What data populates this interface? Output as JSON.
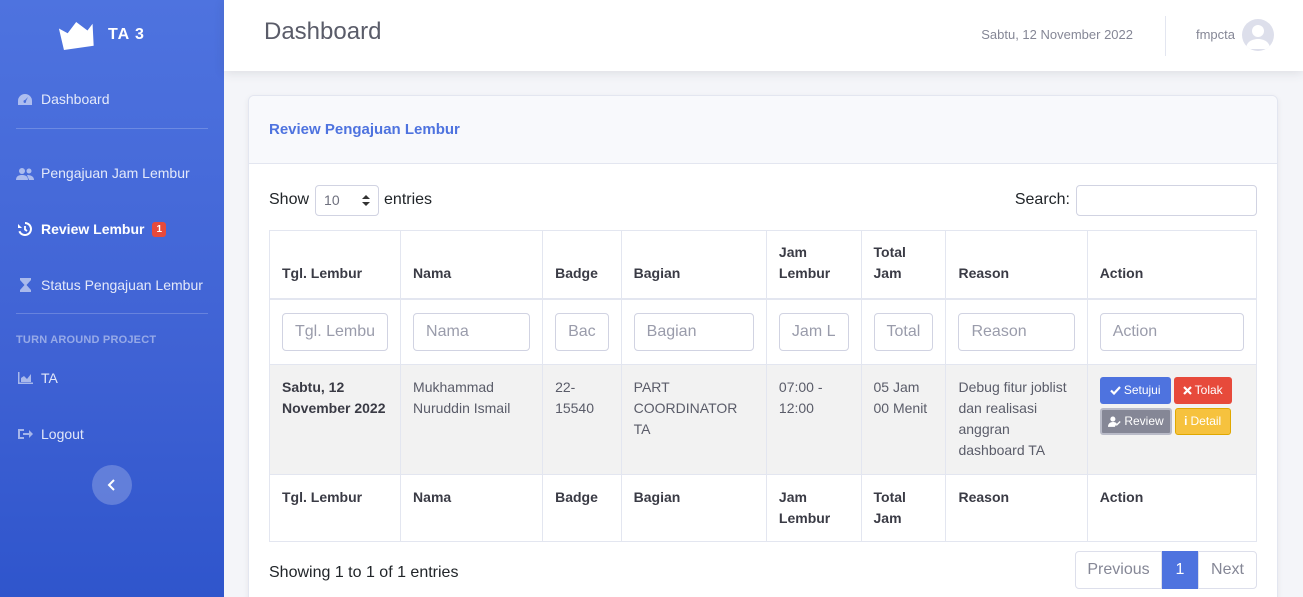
{
  "brand": {
    "name": "TA 3"
  },
  "sidebar": {
    "items": [
      {
        "label": "Dashboard",
        "icon": "tachometer-icon"
      },
      {
        "label": "Pengajuan Jam Lembur",
        "icon": "users-icon"
      },
      {
        "label": "Review Lembur",
        "icon": "history-icon",
        "badge": "1"
      },
      {
        "label": "Status Pengajuan Lembur",
        "icon": "hourglass-icon"
      }
    ],
    "heading": "TURN AROUND PROJECT",
    "project_items": [
      {
        "label": "TA",
        "icon": "chart-area-icon"
      },
      {
        "label": "Logout",
        "icon": "sign-out-icon"
      }
    ]
  },
  "header": {
    "title": "Dashboard",
    "date": "Sabtu, 12 November 2022",
    "username": "fmpcta"
  },
  "card": {
    "title": "Review Pengajuan Lembur",
    "show_label": "Show",
    "entries_value": "10",
    "entries_label": "entries",
    "search_label": "Search:"
  },
  "table": {
    "headers": [
      "Tgl. Lembur",
      "Nama",
      "Badge",
      "Bagian",
      "Jam Lembur",
      "Total Jam",
      "Reason",
      "Action"
    ],
    "filters": [
      "Tgl. Lembu",
      "Nama",
      "Bac",
      "Bagian",
      "Jam L",
      "Total",
      "Reason",
      "Action"
    ],
    "rows": [
      {
        "tgl": "Sabtu, 12 November 2022",
        "nama": "Mukhammad Nuruddin Ismail",
        "badge": "22-15540",
        "bagian": "PART COORDINATOR TA",
        "jam": "07:00 - 12:00",
        "total": "05 Jam 00 Menit",
        "reason": "Debug fitur joblist dan realisasi anggran dashboard TA",
        "actions": {
          "setujui": "Setujui",
          "tolak": "Tolak",
          "review": "Review",
          "detail": "Detail"
        }
      }
    ]
  },
  "footer": {
    "info": "Showing 1 to 1 of 1 entries",
    "prev": "Previous",
    "page": "1",
    "next": "Next"
  },
  "colors": {
    "primary": "#4e73df",
    "danger": "#e74a3b",
    "warning": "#f6c23e",
    "secondary": "#858796"
  }
}
